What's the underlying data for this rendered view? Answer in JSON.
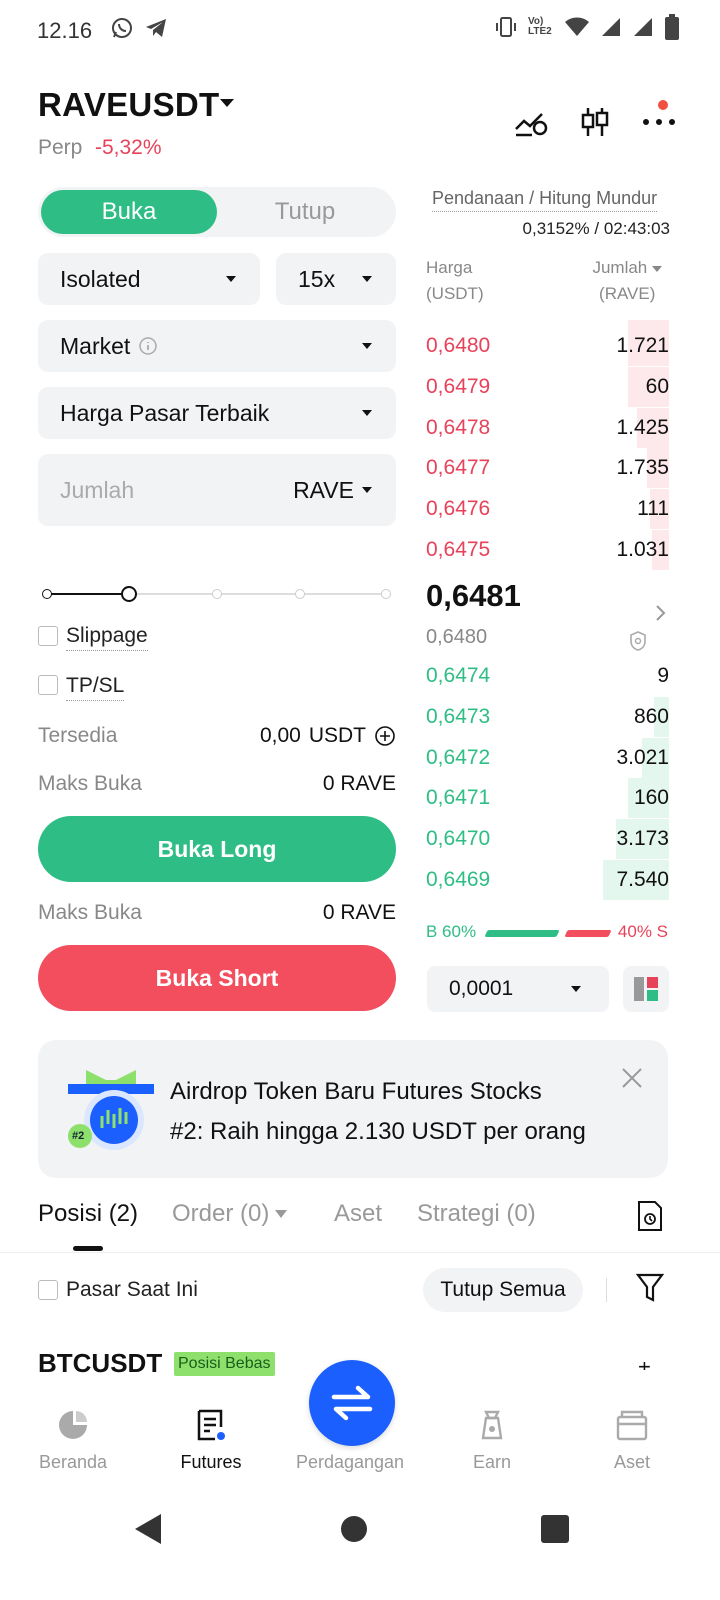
{
  "status_bar": {
    "time": "12.16",
    "network_label": "Vo) LTE2"
  },
  "header": {
    "pair": "RAVEUSDT",
    "type": "Perp",
    "change": "-5,32%"
  },
  "order_form": {
    "toggle": {
      "open": "Buka",
      "close": "Tutup"
    },
    "margin_mode": "Isolated",
    "leverage": "15x",
    "order_type": "Market",
    "price_mode": "Harga Pasar Terbaik",
    "amount_placeholder": "Jumlah",
    "amount_unit": "RAVE",
    "slippage_label": "Slippage",
    "tpsl_label": "TP/SL",
    "available_label": "Tersedia",
    "available_value": "0,00",
    "available_unit": "USDT",
    "max_open_label": "Maks Buka",
    "max_open_long": "0 RAVE",
    "max_open_short": "0 RAVE",
    "long_button": "Buka Long",
    "short_button": "Buka Short"
  },
  "order_book": {
    "funding_label": "Pendanaan / Hitung Mundur",
    "funding_rate": "0,3152%",
    "countdown": "02:43:03",
    "col_price": "Harga",
    "col_price_unit": "(USDT)",
    "col_amount": "Jumlah",
    "col_amount_unit": "(RAVE)",
    "asks": [
      {
        "price": "0,6480",
        "amount": "1.721",
        "depth": 0.17
      },
      {
        "price": "0,6479",
        "amount": "60",
        "depth": 0.17
      },
      {
        "price": "0,6478",
        "amount": "1.425",
        "depth": 0.13
      },
      {
        "price": "0,6477",
        "amount": "1.735",
        "depth": 0.09
      },
      {
        "price": "0,6476",
        "amount": "111",
        "depth": 0.08
      },
      {
        "price": "0,6475",
        "amount": "1.031",
        "depth": 0.07
      }
    ],
    "last_price": "0,6481",
    "mark_price": "0,6480",
    "bids": [
      {
        "price": "0,6474",
        "amount": "9",
        "depth": 0.0
      },
      {
        "price": "0,6473",
        "amount": "860",
        "depth": 0.06
      },
      {
        "price": "0,6472",
        "amount": "3.021",
        "depth": 0.11
      },
      {
        "price": "0,6471",
        "amount": "160",
        "depth": 0.17
      },
      {
        "price": "0,6470",
        "amount": "3.173",
        "depth": 0.22
      },
      {
        "price": "0,6469",
        "amount": "7.540",
        "depth": 0.27
      }
    ],
    "buy_ratio": "B 60%",
    "sell_ratio": "40% S",
    "precision": "0,0001",
    "colors": {
      "ask": "#e8425a",
      "bid": "#2ebd85",
      "ask_bg": "#fde8eb",
      "bid_bg": "#e4f7ee"
    }
  },
  "banner": {
    "line1": "Airdrop Token Baru Futures Stocks",
    "line2": "#2: Raih hingga 2.130 USDT per orang",
    "badge": "#2"
  },
  "tabs": {
    "positions": "Posisi (2)",
    "orders": "Order (0)",
    "assets": "Aset",
    "strategies": "Strategi (0)"
  },
  "positions": {
    "current_market_label": "Pasar Saat Ini",
    "close_all": "Tutup Semua",
    "first_symbol": "BTCUSDT",
    "first_badge": "Posisi Bebas"
  },
  "bottom_nav": {
    "home": "Beranda",
    "futures": "Futures",
    "trade": "Perdagangan",
    "earn": "Earn",
    "assets": "Aset"
  }
}
